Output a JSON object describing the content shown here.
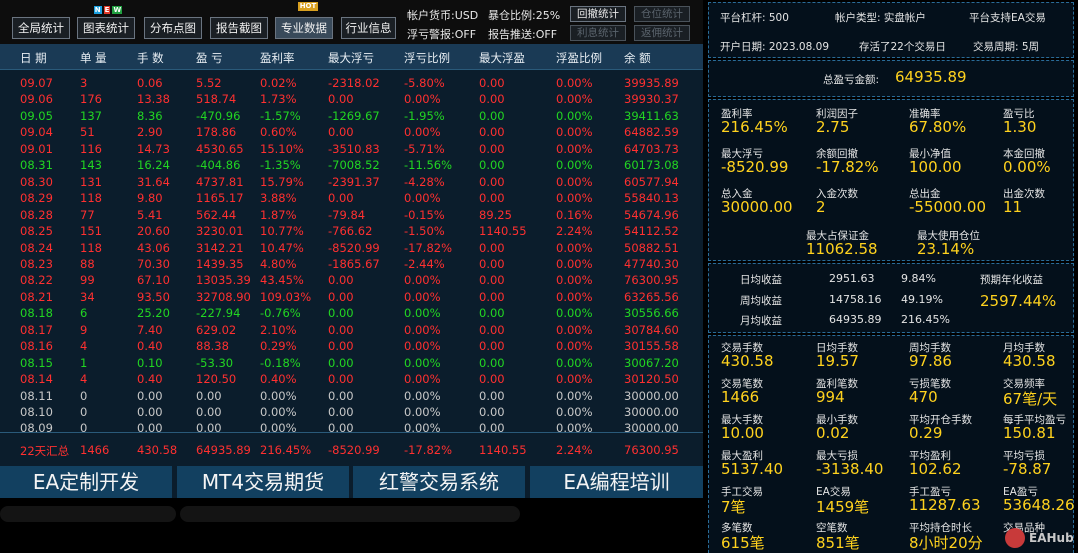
{
  "toolbar": {
    "buttons": [
      "全局统计",
      "图表统计",
      "分布点图",
      "报告截图",
      "专业数据",
      "行业信息"
    ],
    "badge_new": "N E W",
    "badge_hot": "HOT",
    "account_currency": "帐户货币:USD",
    "warehouse_ratio": "暴仓比例:25%",
    "float_warning": "浮亏警报:OFF",
    "report_push": "报告推送:OFF",
    "btn_drawdown": "回撤统计",
    "btn_position": "仓位统计",
    "btn_interest": "利息统计",
    "btn_rebate": "返佣统计"
  },
  "table": {
    "headers": [
      "日 期",
      "单 量",
      "手 数",
      "盈 亏",
      "盈利率",
      "最大浮亏",
      "浮亏比例",
      "最大浮盈",
      "浮盈比例",
      "余 额"
    ],
    "rows": [
      {
        "c": "r",
        "v": [
          "09.07",
          "3",
          "0.06",
          "5.52",
          "0.02%",
          "-2318.02",
          "-5.80%",
          "0.00",
          "0.00%",
          "39935.89"
        ]
      },
      {
        "c": "r",
        "v": [
          "09.06",
          "176",
          "13.38",
          "518.74",
          "1.73%",
          "0.00",
          "0.00%",
          "0.00",
          "0.00%",
          "39930.37"
        ]
      },
      {
        "c": "g",
        "v": [
          "09.05",
          "137",
          "8.36",
          "-470.96",
          "-1.57%",
          "-1269.67",
          "-1.95%",
          "0.00",
          "0.00%",
          "39411.63"
        ]
      },
      {
        "c": "r",
        "v": [
          "09.04",
          "51",
          "2.90",
          "178.86",
          "0.60%",
          "0.00",
          "0.00%",
          "0.00",
          "0.00%",
          "64882.59"
        ]
      },
      {
        "c": "r",
        "v": [
          "09.01",
          "116",
          "14.73",
          "4530.65",
          "15.10%",
          "-3510.83",
          "-5.71%",
          "0.00",
          "0.00%",
          "64703.73"
        ]
      },
      {
        "c": "g",
        "v": [
          "08.31",
          "143",
          "16.24",
          "-404.86",
          "-1.35%",
          "-7008.52",
          "-11.56%",
          "0.00",
          "0.00%",
          "60173.08"
        ]
      },
      {
        "c": "r",
        "v": [
          "08.30",
          "131",
          "31.64",
          "4737.81",
          "15.79%",
          "-2391.37",
          "-4.28%",
          "0.00",
          "0.00%",
          "60577.94"
        ]
      },
      {
        "c": "r",
        "v": [
          "08.29",
          "118",
          "9.80",
          "1165.17",
          "3.88%",
          "0.00",
          "0.00%",
          "0.00",
          "0.00%",
          "55840.13"
        ]
      },
      {
        "c": "r",
        "v": [
          "08.28",
          "77",
          "5.41",
          "562.44",
          "1.87%",
          "-79.84",
          "-0.15%",
          "89.25",
          "0.16%",
          "54674.96"
        ]
      },
      {
        "c": "r",
        "v": [
          "08.25",
          "151",
          "20.60",
          "3230.01",
          "10.77%",
          "-766.62",
          "-1.50%",
          "1140.55",
          "2.24%",
          "54112.52"
        ]
      },
      {
        "c": "r",
        "v": [
          "08.24",
          "118",
          "43.06",
          "3142.21",
          "10.47%",
          "-8520.99",
          "-17.82%",
          "0.00",
          "0.00%",
          "50882.51"
        ]
      },
      {
        "c": "r",
        "v": [
          "08.23",
          "88",
          "70.30",
          "1439.35",
          "4.80%",
          "-1865.67",
          "-2.44%",
          "0.00",
          "0.00%",
          "47740.30"
        ]
      },
      {
        "c": "r",
        "v": [
          "08.22",
          "99",
          "67.10",
          "13035.39",
          "43.45%",
          "0.00",
          "0.00%",
          "0.00",
          "0.00%",
          "76300.95"
        ]
      },
      {
        "c": "r",
        "v": [
          "08.21",
          "34",
          "93.50",
          "32708.90",
          "109.03%",
          "0.00",
          "0.00%",
          "0.00",
          "0.00%",
          "63265.56"
        ]
      },
      {
        "c": "g",
        "v": [
          "08.18",
          "6",
          "25.20",
          "-227.94",
          "-0.76%",
          "0.00",
          "0.00%",
          "0.00",
          "0.00%",
          "30556.66"
        ]
      },
      {
        "c": "r",
        "v": [
          "08.17",
          "9",
          "7.40",
          "629.02",
          "2.10%",
          "0.00",
          "0.00%",
          "0.00",
          "0.00%",
          "30784.60"
        ]
      },
      {
        "c": "r",
        "v": [
          "08.16",
          "4",
          "0.40",
          "88.38",
          "0.29%",
          "0.00",
          "0.00%",
          "0.00",
          "0.00%",
          "30155.58"
        ]
      },
      {
        "c": "g",
        "v": [
          "08.15",
          "1",
          "0.10",
          "-53.30",
          "-0.18%",
          "0.00",
          "0.00%",
          "0.00",
          "0.00%",
          "30067.20"
        ]
      },
      {
        "c": "r",
        "v": [
          "08.14",
          "4",
          "0.40",
          "120.50",
          "0.40%",
          "0.00",
          "0.00%",
          "0.00",
          "0.00%",
          "30120.50"
        ]
      },
      {
        "c": "w",
        "v": [
          "08.11",
          "0",
          "0.00",
          "0.00",
          "0.00%",
          "0.00",
          "0.00%",
          "0.00",
          "0.00%",
          "30000.00"
        ]
      },
      {
        "c": "w",
        "v": [
          "08.10",
          "0",
          "0.00",
          "0.00",
          "0.00%",
          "0.00",
          "0.00%",
          "0.00",
          "0.00%",
          "30000.00"
        ]
      },
      {
        "c": "w",
        "v": [
          "08.09",
          "0",
          "0.00",
          "0.00",
          "0.00%",
          "0.00",
          "0.00%",
          "0.00",
          "0.00%",
          "30000.00"
        ]
      }
    ],
    "summary": [
      "22天汇总",
      "1466",
      "430.58",
      "64935.89",
      "216.45%",
      "-8520.99",
      "-17.82%",
      "1140.55",
      "2.24%",
      "76300.95"
    ]
  },
  "banner": [
    "EA定制开发",
    "MT4交易期货",
    "红警交易系统",
    "EA编程培训"
  ],
  "colors": {
    "red": "#ff3030",
    "green": "#22d622",
    "gray": "#c8c8c8",
    "yellow": "#ffd21e",
    "header_bg": "#1a3a55"
  },
  "right": {
    "platform_leverage": "平台杠杆: 500",
    "account_type": "帐户类型: 实盘帐户",
    "platform_support": "平台支持EA交易",
    "open_date": "开户日期: 2023.08.09",
    "survive": "存活了22个交易日",
    "trade_cycle": "交易周期: 5周",
    "total_profit_label": "总盈亏金额:",
    "total_profit_value": "64935.89",
    "g1": [
      {
        "l": "盈利率",
        "v": "216.45%"
      },
      {
        "l": "利润因子",
        "v": "2.75"
      },
      {
        "l": "准确率",
        "v": "67.80%"
      },
      {
        "l": "盈亏比",
        "v": "1.30"
      },
      {
        "l": "最大浮亏",
        "v": "-8520.99"
      },
      {
        "l": "余额回撤",
        "v": "-17.82%"
      },
      {
        "l": "最小净值",
        "v": "100.00"
      },
      {
        "l": "本金回撤",
        "v": "0.00%"
      },
      {
        "l": "总入金",
        "v": "30000.00"
      },
      {
        "l": "入金次数",
        "v": "2"
      },
      {
        "l": "总出金",
        "v": "-55000.00"
      },
      {
        "l": "出金次数",
        "v": "11"
      }
    ],
    "max_margin_label": "最大占保证金",
    "max_margin_value": "11062.58",
    "max_position_label": "最大使用仓位",
    "max_position_value": "23.14%",
    "daily_label": "日均收益",
    "daily_value": "2951.63",
    "daily_pct": "9.84%",
    "weekly_label": "周均收益",
    "weekly_value": "14758.16",
    "weekly_pct": "49.19%",
    "monthly_label": "月均收益",
    "monthly_value": "64935.89",
    "monthly_pct": "216.45%",
    "annual_label": "预期年化收益",
    "annual_value": "2597.44%",
    "g2": [
      {
        "l": "交易手数",
        "v": "430.58"
      },
      {
        "l": "日均手数",
        "v": "19.57"
      },
      {
        "l": "周均手数",
        "v": "97.86"
      },
      {
        "l": "月均手数",
        "v": "430.58"
      },
      {
        "l": "交易笔数",
        "v": "1466"
      },
      {
        "l": "盈利笔数",
        "v": "994"
      },
      {
        "l": "亏损笔数",
        "v": "470"
      },
      {
        "l": "交易频率",
        "v": "67笔/天"
      },
      {
        "l": "最大手数",
        "v": "10.00"
      },
      {
        "l": "最小手数",
        "v": "0.02"
      },
      {
        "l": "平均开仓手数",
        "v": "0.29"
      },
      {
        "l": "每手平均盈亏",
        "v": "150.81"
      },
      {
        "l": "最大盈利",
        "v": "5137.40"
      },
      {
        "l": "最大亏损",
        "v": "-3138.40"
      },
      {
        "l": "平均盈利",
        "v": "102.62"
      },
      {
        "l": "平均亏损",
        "v": "-78.87"
      },
      {
        "l": "手工交易",
        "v": "7笔"
      },
      {
        "l": "EA交易",
        "v": "1459笔"
      },
      {
        "l": "手工盈亏",
        "v": "11287.63"
      },
      {
        "l": "EA盈亏",
        "v": "53648.26"
      },
      {
        "l": "多笔数",
        "v": "615笔"
      },
      {
        "l": "空笔数",
        "v": "851笔"
      },
      {
        "l": "平均持仓时长",
        "v": "8小时20分"
      },
      {
        "l": "交易品种",
        "v": ""
      }
    ],
    "watermark": "EAHub"
  }
}
